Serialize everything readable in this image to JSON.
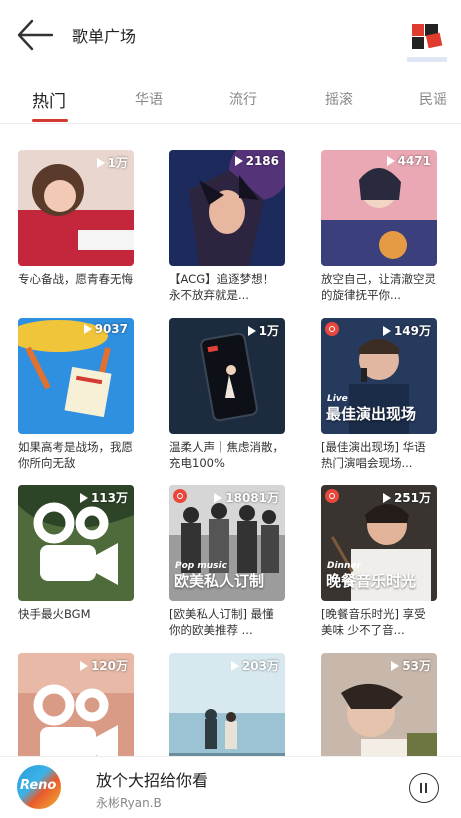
{
  "header": {
    "title": "歌单广场"
  },
  "tabs": [
    "热门",
    "华语",
    "流行",
    "摇滚",
    "民谣"
  ],
  "playlists": [
    {
      "count": "1万",
      "caption": "专心备战，愿青春无悔",
      "icon": "girl-studying-cover"
    },
    {
      "count": "2186",
      "caption": "【ACG】追逐梦想！永不放弃就是...",
      "icon": "anime-boy-cover"
    },
    {
      "count": "4471",
      "caption": "放空自己，让清澈空灵的旋律抚平你...",
      "icon": "illustrated-girl-cover"
    },
    {
      "count": "9037",
      "caption": "如果高考是战场，我愿你所向无敌",
      "icon": "exam-card-cover"
    },
    {
      "count": "1万",
      "caption": "温柔人声｜焦虑消散，充电100%",
      "icon": "phone-battery-cover"
    },
    {
      "count": "149万",
      "caption": "[最佳演出现场] 华语热门演唱会现场...",
      "icon": "live-singer-cover",
      "tag": "Live",
      "big_text": "最佳演出现场"
    },
    {
      "count": "113万",
      "caption": "快手最火BGM",
      "icon": "kuaishou-logo-cover"
    },
    {
      "count": "18081万",
      "caption": "[欧美私人订制] 最懂你的欧美推荐 ...",
      "icon": "band-photo-cover",
      "tag": "Pop music",
      "big_text": "欧美私人订制"
    },
    {
      "count": "251万",
      "caption": "[晚餐音乐时光] 享受美味 少不了音...",
      "icon": "dinner-cover",
      "tag": "Dinner",
      "big_text": "晚餐音乐时光"
    },
    {
      "count": "120万",
      "caption": "",
      "icon": "kuaishou-logo-cover"
    },
    {
      "count": "203万",
      "caption": "",
      "icon": "seaside-couple-cover"
    },
    {
      "count": "53万",
      "caption": "",
      "icon": "sleeping-girl-cover"
    }
  ],
  "player": {
    "song": "放个大招给你看",
    "artist": "永彬Ryan.B",
    "disc_text": "Reno"
  },
  "colors": {
    "accent": "#d33a31",
    "badge": "#e8473b"
  }
}
